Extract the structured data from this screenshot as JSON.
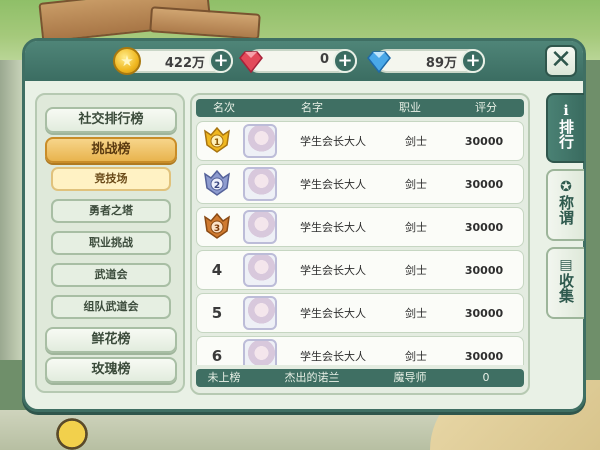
{
  "currency": {
    "gold": "422万",
    "ruby": "0",
    "diamond": "89万"
  },
  "left_menu": [
    {
      "label": "社交排行榜",
      "type": "main",
      "active": false
    },
    {
      "label": "挑战榜",
      "type": "main",
      "active": true
    },
    {
      "label": "竞技场",
      "type": "sub",
      "active": true
    },
    {
      "label": "勇者之塔",
      "type": "sub",
      "active": false
    },
    {
      "label": "职业挑战",
      "type": "sub",
      "active": false
    },
    {
      "label": "武道会",
      "type": "sub",
      "active": false
    },
    {
      "label": "组队武道会",
      "type": "sub",
      "active": false
    },
    {
      "label": "鲜花榜",
      "type": "main",
      "active": false
    },
    {
      "label": "玫瑰榜",
      "type": "main",
      "active": false
    }
  ],
  "right_tabs": [
    {
      "label": "排行",
      "icon": "info-icon",
      "active": true
    },
    {
      "label": "称谓",
      "icon": "star-badge-icon",
      "active": false
    },
    {
      "label": "收集",
      "icon": "book-icon",
      "active": false
    }
  ],
  "table": {
    "headers": [
      "名次",
      "名字",
      "职业",
      "评分"
    ],
    "rows": [
      {
        "rank": "1",
        "medal": "gold",
        "name": "学生会长大人",
        "job": "剑士",
        "score": "30000"
      },
      {
        "rank": "2",
        "medal": "silver",
        "name": "学生会长大人",
        "job": "剑士",
        "score": "30000"
      },
      {
        "rank": "3",
        "medal": "bronze",
        "name": "学生会长大人",
        "job": "剑士",
        "score": "30000"
      },
      {
        "rank": "4",
        "medal": "",
        "name": "学生会长大人",
        "job": "剑士",
        "score": "30000"
      },
      {
        "rank": "5",
        "medal": "",
        "name": "学生会长大人",
        "job": "剑士",
        "score": "30000"
      },
      {
        "rank": "6",
        "medal": "",
        "name": "学生会长大人",
        "job": "剑士",
        "score": "30000"
      }
    ],
    "self_row": {
      "rank": "未上榜",
      "name": "杰出的诺兰",
      "job": "魔导师",
      "score": "0"
    }
  },
  "colors": {
    "frame": "#3f6f63",
    "active_tab": "#e8b44e",
    "gold_medal": "#f0b820",
    "silver_medal": "#8e9ccf",
    "bronze_medal": "#cf7a30"
  }
}
